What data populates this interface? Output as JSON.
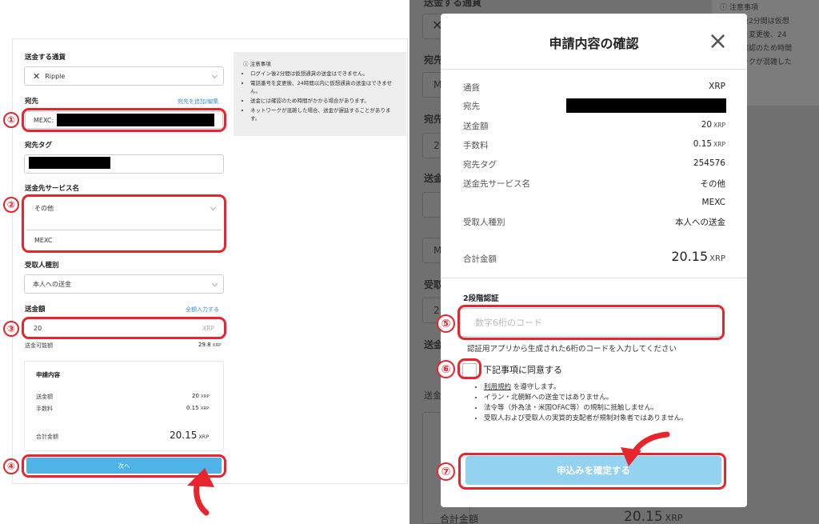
{
  "left": {
    "currency_label": "送金する通貨",
    "currency_value": "Ripple",
    "address_label": "宛先",
    "address_link": "宛先を追加/編集",
    "address_prefix": "MEXC:",
    "tag_label": "宛先タグ",
    "service_label": "送金先サービス名",
    "service_value": "その他",
    "service_other": "MEXC",
    "recipient_label": "受取人種別",
    "recipient_value": "本人への送金",
    "amount_label": "送金額",
    "amount_link": "全額入力する",
    "amount_value": "20",
    "amount_unit": "XRP",
    "available_label": "送金可能額",
    "available_value": "29.8",
    "available_unit": "XRP",
    "summary": {
      "title": "申請内容",
      "rows": [
        {
          "label": "送金額",
          "value": "20",
          "unit": "XRP"
        },
        {
          "label": "手数料",
          "value": "0.15",
          "unit": "XRP"
        }
      ],
      "total_label": "合計金額",
      "total_value": "20.15",
      "total_unit": "XRP"
    },
    "next_button": "次へ",
    "notes": {
      "title": "ⓘ 注意事項",
      "items": [
        "ログイン後2分間は仮想通貨の送金はできません。",
        "電話番号を変更後、24時間以内に仮想通貨の送金はできません。",
        "送金には確認のため時間がかかる場合があります。",
        "ネットワークが混雑した場合、送金が遅延することがあります。"
      ]
    }
  },
  "background": {
    "labels": [
      "送金する通貨",
      "宛先",
      "宛先タグ",
      "送金先サービス名",
      "受取人種別",
      "送金額"
    ],
    "notes_title": "ⓘ 注意事項",
    "notes_lines": [
      "グイン後2分間は仮想",
      "話番号を変更後、24",
      "金には確認のため時間",
      "ットワークが混雑した"
    ],
    "total_label": "合計金額",
    "total_value": "20.15",
    "total_unit": "XRP",
    "fragments": [
      "送金可",
      "M",
      "2",
      "M",
      "2"
    ]
  },
  "modal": {
    "title": "申請内容の確認",
    "close_icon": "×",
    "rows": [
      {
        "label": "通貨",
        "value": "XRP"
      },
      {
        "label": "宛先",
        "value": ""
      },
      {
        "label": "送金額",
        "value": "20",
        "unit": "XRP"
      },
      {
        "label": "手数料",
        "value": "0.15",
        "unit": "XRP"
      },
      {
        "label": "宛先タグ",
        "value": "254576"
      },
      {
        "label": "送金先サービス名",
        "value": "その他"
      },
      {
        "label": "",
        "value": "MEXC"
      },
      {
        "label": "受取人種別",
        "value": "本人への送金"
      }
    ],
    "total_label": "合計金額",
    "total_value": "20.15",
    "total_unit": "XRP",
    "twofa_title": "2段階認証",
    "code_placeholder": "数字6桁のコード",
    "code_hint": "認証用アプリから生成された6桁のコードを入力してください",
    "agree_label": "下記事項に同意する",
    "terms_link": "利用規約",
    "terms_suffix": " を遵守します。",
    "agree_items": [
      "イラン・北朝鮮への送金ではありません。",
      "法令等（外為法・米国OFAC等）の規制に抵触しません。",
      "受取人および受取人の実質的支配者が規制対象者ではありません。"
    ],
    "confirm_button": "申込みを確定する"
  },
  "markers": [
    "①",
    "②",
    "③",
    "④",
    "⑤",
    "⑥",
    "⑦"
  ],
  "colors": {
    "accent": "#e8242d",
    "button": "#4fb3e8",
    "button_light": "#94d3f0",
    "overlay": "#707070"
  }
}
